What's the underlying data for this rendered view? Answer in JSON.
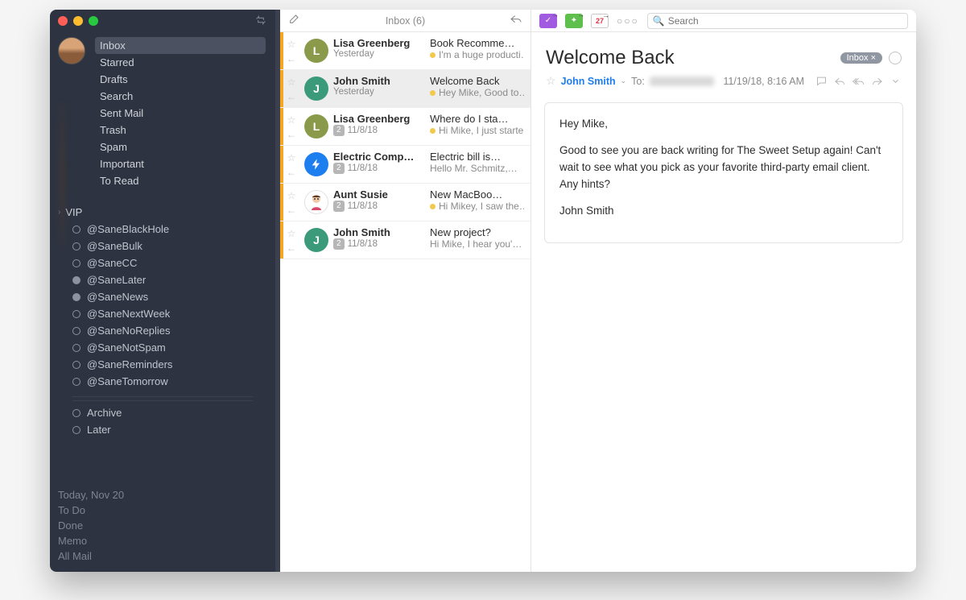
{
  "sidebar": {
    "folders": [
      "Inbox",
      "Starred",
      "Drafts",
      "Search",
      "Sent Mail",
      "Trash",
      "Spam",
      "Important",
      "To Read"
    ],
    "selected_index": 0,
    "vip_label": "VIP",
    "tags": [
      "@SaneBlackHole",
      "@SaneBulk",
      "@SaneCC",
      "@SaneLater",
      "@SaneNews",
      "@SaneNextWeek",
      "@SaneNoReplies",
      "@SaneNotSpam",
      "@SaneReminders",
      "@SaneTomorrow",
      "Archive",
      "Later"
    ],
    "smart": [
      "Today, Nov 20",
      "To Do",
      "Done",
      "Memo",
      "All Mail"
    ]
  },
  "list": {
    "title": "Inbox (6)",
    "messages": [
      {
        "from": "Lisa Greenberg",
        "date": "Yesterday",
        "subject": "Book Recomme…",
        "preview": "I'm a huge producti…",
        "avatar": "L",
        "color": "av-L",
        "unread": true,
        "pinned": true,
        "count": ""
      },
      {
        "from": "John Smith",
        "date": "Yesterday",
        "subject": "Welcome Back",
        "preview": "Hey Mike, Good to…",
        "avatar": "J",
        "color": "av-J",
        "unread": true,
        "pinned": true,
        "count": "",
        "selected": true
      },
      {
        "from": "Lisa Greenberg",
        "date": "11/8/18",
        "subject": "Where do I sta…",
        "preview": "Hi Mike, I just starte…",
        "avatar": "L",
        "color": "av-L",
        "unread": true,
        "pinned": true,
        "count": "2"
      },
      {
        "from": "Electric Comp…",
        "date": "11/8/18",
        "subject": "Electric bill is…",
        "preview": "Hello Mr. Schmitz,…",
        "avatar": "bolt",
        "color": "av-bolt",
        "unread": true,
        "pinned": false,
        "count": "2"
      },
      {
        "from": "Aunt Susie",
        "date": "11/8/18",
        "subject": "New MacBoo…",
        "preview": "Hi Mikey, I saw the…",
        "avatar": "face",
        "color": "av-face",
        "unread": true,
        "pinned": true,
        "count": "2"
      },
      {
        "from": "John Smith",
        "date": "11/8/18",
        "subject": "New project?",
        "preview": "Hi Mike, I hear you'…",
        "avatar": "J",
        "color": "av-J",
        "unread": true,
        "pinned": false,
        "count": "2"
      }
    ]
  },
  "reader": {
    "toolbar": {
      "calendar_day": "27",
      "search_placeholder": "Search"
    },
    "subject": "Welcome Back",
    "inbox_pill": "Inbox ×",
    "sender": "John Smith",
    "to_label": "To:",
    "datetime": "11/19/18, 8:16 AM",
    "body": {
      "p1": "Hey Mike,",
      "p2": "Good to see you are back writing for The Sweet Setup again! Can't wait to see what you pick as your favorite third-party email client. Any hints?",
      "p3": "John Smith"
    }
  }
}
